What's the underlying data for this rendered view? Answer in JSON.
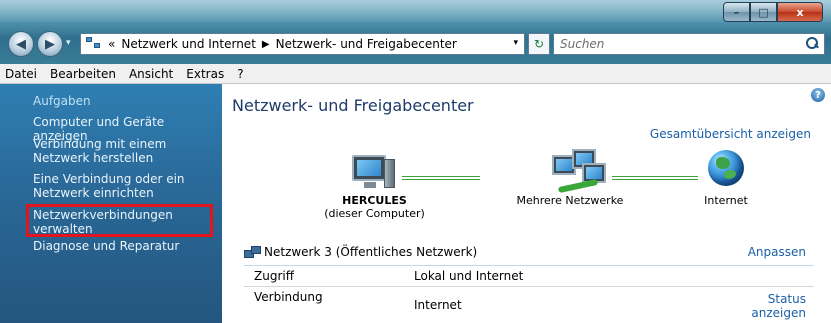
{
  "window": {
    "controls": {
      "minimize": "–",
      "maximize": "□",
      "close": "x"
    }
  },
  "navigation": {
    "back_glyph": "◀",
    "forward_glyph": "▶",
    "dropdown_glyph": "▾",
    "address": {
      "overflow": "«",
      "crumbs": [
        "Netzwerk und Internet",
        "Netzwerk- und Freigabecenter"
      ],
      "separator": "▶",
      "dropdown": "▾"
    },
    "refresh_glyph": "↻",
    "search": {
      "placeholder": "Suchen"
    }
  },
  "menu": [
    "Datei",
    "Bearbeiten",
    "Ansicht",
    "Extras",
    "?"
  ],
  "tasks": {
    "heading": "Aufgaben",
    "items": [
      {
        "line1": "Computer und Geräte anzeigen",
        "line2": ""
      },
      {
        "line1": "Verbindung mit einem",
        "line2": "Netzwerk herstellen"
      },
      {
        "line1": "Eine Verbindung oder ein",
        "line2": "Netzwerk einrichten"
      },
      {
        "line1": "Netzwerkverbindungen",
        "line2": "verwalten"
      },
      {
        "line1": "Diagnose und Reparatur",
        "line2": ""
      }
    ]
  },
  "main": {
    "help_glyph": "?",
    "title": "Netzwerk- und Freigabecenter",
    "overview_link": "Gesamtübersicht anzeigen",
    "map": {
      "computer": {
        "name": "HERCULES",
        "sub": "(dieser Computer)",
        "icon": "computer-icon"
      },
      "network": {
        "name": "Mehrere Netzwerke",
        "icon": "network-icon"
      },
      "internet": {
        "name": "Internet",
        "icon": "globe-icon"
      }
    },
    "network_section": {
      "title": "Netzwerk 3 (Öffentliches Netzwerk)",
      "customize": "Anpassen",
      "rows": [
        {
          "label": "Zugriff",
          "value": "Lokal und Internet"
        },
        {
          "label": "Verbindung",
          "value": "Internet"
        }
      ],
      "status_link": {
        "line1": "Status",
        "line2": "anzeigen"
      }
    }
  },
  "colors": {
    "taskpane": "#2a6a9a",
    "link": "#1a5fa8",
    "highlight": "#e3141b",
    "connection_line": "#3aa23a"
  }
}
